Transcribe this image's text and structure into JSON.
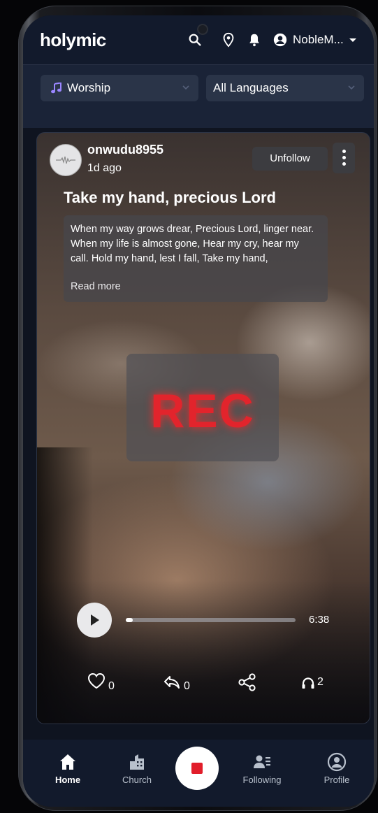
{
  "header": {
    "brand": "holymic",
    "user_name": "NobleM...",
    "icons": [
      "search-icon",
      "location-pin-icon",
      "bell-icon",
      "user-circle-icon",
      "caret-down-icon"
    ]
  },
  "filters": {
    "category": "Worship",
    "language": "All Languages"
  },
  "post": {
    "username": "onwudu8955",
    "time_ago": "1d ago",
    "unfollow_label": "Unfollow",
    "title": "Take my hand, precious Lord",
    "lyrics": "When my way grows drear, Precious Lord, linger near. When my life is almost gone, Hear my cry, hear my call. Hold my hand, lest I fall, Take my hand,",
    "read_more": "Read more",
    "overlay": "REC",
    "duration": "6:38",
    "progress": 0.01,
    "likes": "0",
    "replies": "0",
    "listens": "2"
  },
  "nav": {
    "home": "Home",
    "church": "Church",
    "following": "Following",
    "profile": "Profile"
  },
  "colors": {
    "accent_record": "#e11d2a",
    "background": "#0f1420",
    "header": "#121a2c"
  }
}
